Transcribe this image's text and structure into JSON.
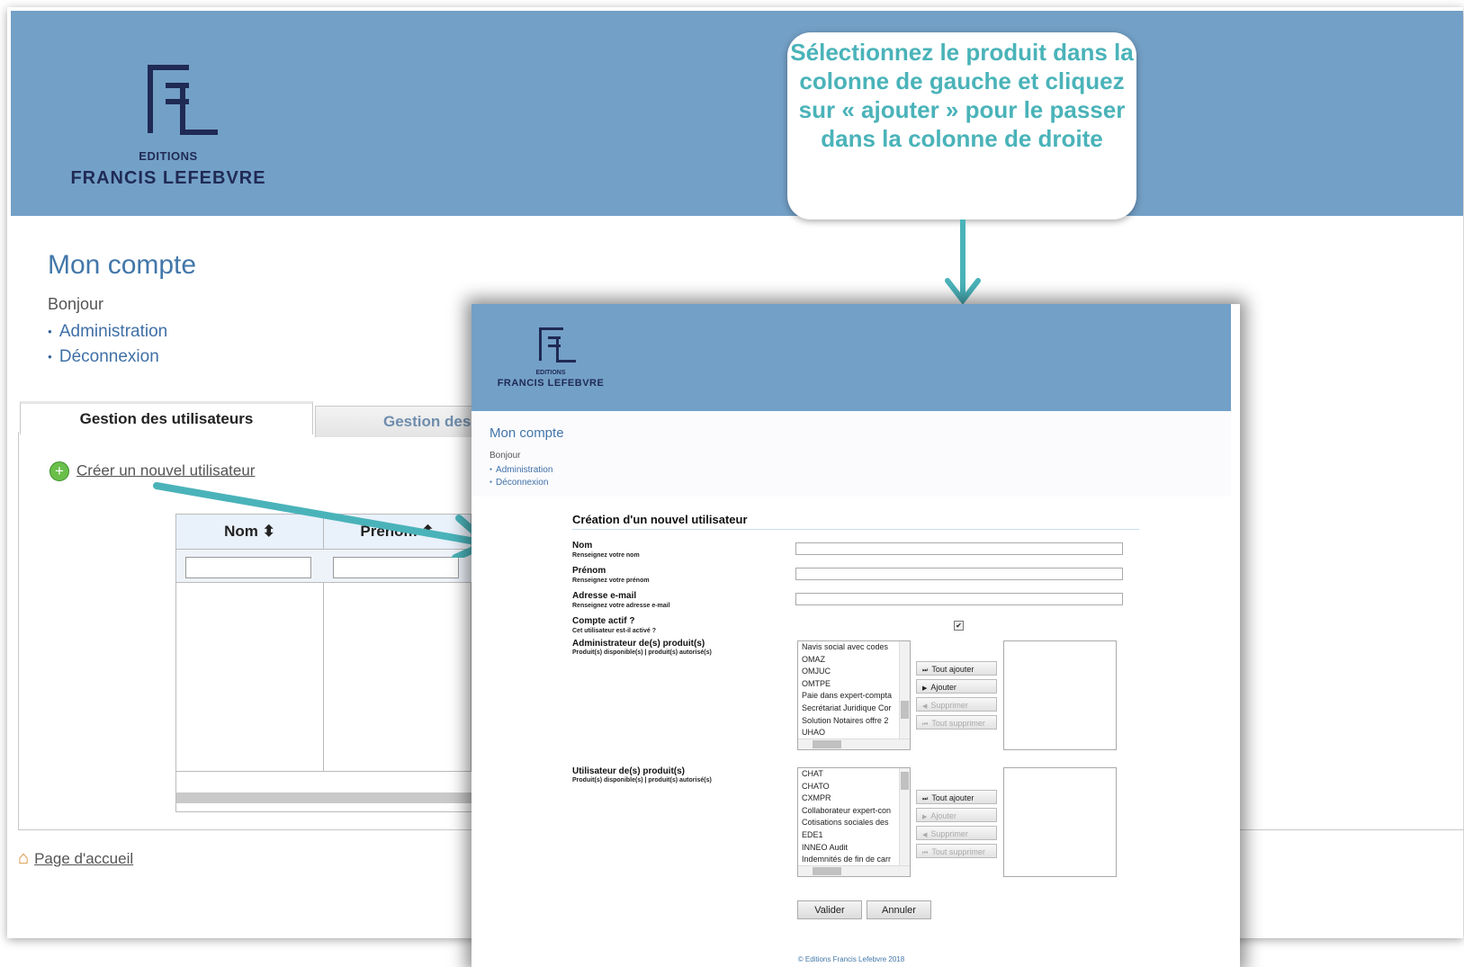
{
  "background": {
    "logo": {
      "editions": "EDITIONS",
      "name": "FRANCIS LEFEBVRE"
    },
    "page_title": "Mon compte",
    "greeting": "Bonjour",
    "nav": [
      {
        "label": "Administration"
      },
      {
        "label": "Déconnexion"
      }
    ],
    "tabs": [
      {
        "label": "Gestion des utilisateurs"
      },
      {
        "label": "Gestion des"
      }
    ],
    "create_user_label": "Créer un nouvel utilisateur",
    "grid": {
      "columns": [
        {
          "label": "Nom ⬍"
        },
        {
          "label": "Prénom ⬍"
        }
      ]
    },
    "home_link": "Page d'accueil"
  },
  "callout": {
    "text": "Sélectionnez le produit dans la colonne de gauche et cliquez sur « ajouter » pour le passer dans la colonne de droite"
  },
  "dialog": {
    "logo": {
      "editions": "EDITIONS",
      "name": "FRANCIS LEFEBVRE"
    },
    "page_title": "Mon compte",
    "greeting": "Bonjour",
    "nav": [
      {
        "label": "Administration"
      },
      {
        "label": "Déconnexion"
      }
    ],
    "form_title": "Création d'un nouvel utilisateur",
    "fields": {
      "nom": {
        "label": "Nom",
        "help": "Renseignez votre nom",
        "value": ""
      },
      "prenom": {
        "label": "Prénom",
        "help": "Renseignez votre prénom",
        "value": ""
      },
      "email": {
        "label": "Adresse e-mail",
        "help": "Renseignez votre adresse e-mail",
        "value": ""
      },
      "actif": {
        "label": "Compte actif ?",
        "help": "Cet utilisateur est-il activé ?",
        "checked": true,
        "check_glyph": "✔"
      }
    },
    "admin_products": {
      "label": "Administrateur de(s) produit(s)",
      "help": "Produit(s) disponible(s) | produit(s) autorisé(s)",
      "available": [
        "Navis social avec codes",
        "OMAZ",
        "OMJUC",
        "OMTPE",
        "Paie dans expert-compta",
        "Secrétariat Juridique Cor",
        "Solution Notaires offre 2",
        "UHAO"
      ],
      "scroll_position": 0.75
    },
    "user_products": {
      "label": "Utilisateur de(s) produit(s)",
      "help": "Produit(s) disponible(s) | produit(s) autorisé(s)",
      "available": [
        "CHAT",
        "CHATO",
        "CXMPR",
        "Collaborateur expert-con",
        "Cotisations sociales des",
        "EDE1",
        "INNEO Audit",
        "Indemnités de fin de carr"
      ],
      "scroll_position": 0.05
    },
    "buttons": {
      "add_all": "Tout ajouter",
      "add": "Ajouter",
      "remove": "Supprimer",
      "remove_all": "Tout supprimer",
      "add_all_glyph": "⏭",
      "add_glyph": "▶",
      "remove_glyph": "◀",
      "remove_all_glyph": "⏮"
    },
    "validate": "Valider",
    "cancel": "Annuler",
    "footer": "© Editions Francis Lefebvre 2018"
  },
  "colors": {
    "header": "#73a0c7",
    "callout_text": "#4ab3b9",
    "link": "#3f6fa6",
    "title": "#4277a9"
  }
}
